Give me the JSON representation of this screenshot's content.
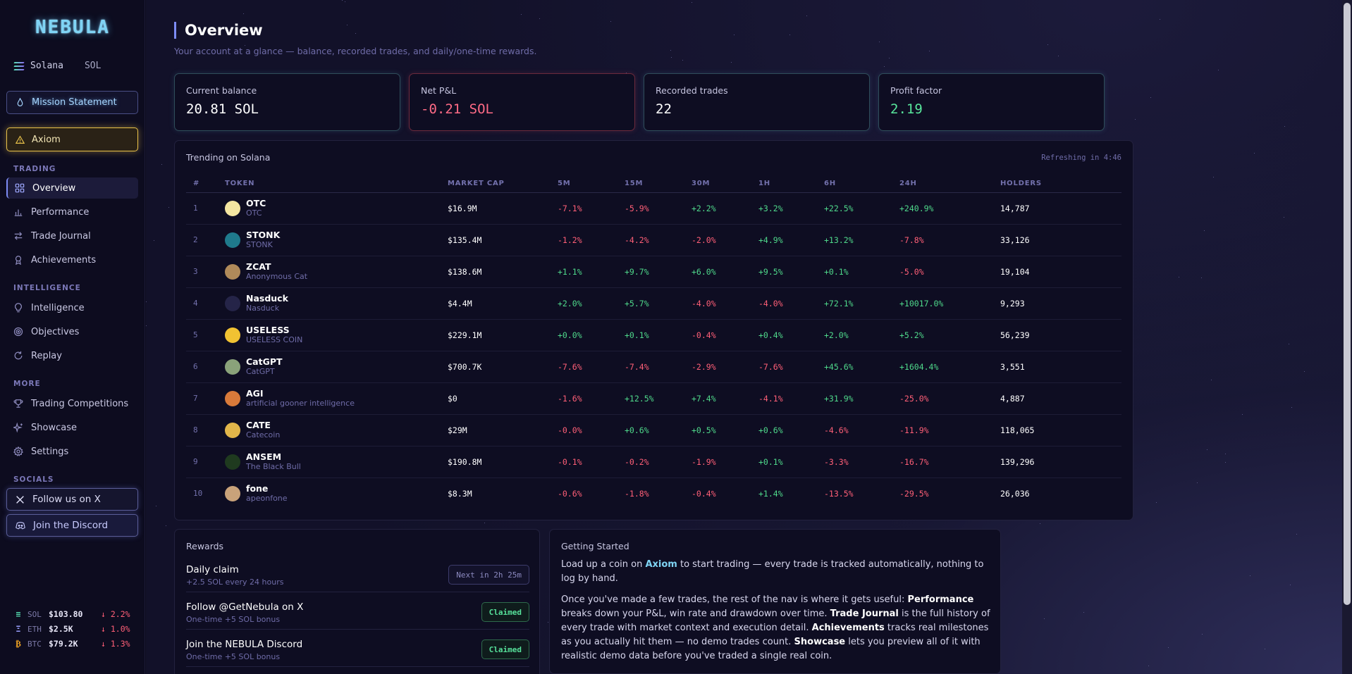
{
  "sidebar": {
    "brand": "NEBULA",
    "chain": {
      "name": "Solana",
      "ticker": "SOL"
    },
    "mission_label": "Mission Statement",
    "axiom_label": "Axiom",
    "sections": {
      "trading": "TRADING",
      "intelligence": "INTELLIGENCE",
      "more": "MORE",
      "socials": "SOCIALS"
    },
    "items": [
      {
        "label": "Overview",
        "icon": "grid-icon"
      },
      {
        "label": "Performance",
        "icon": "bar-chart-icon"
      },
      {
        "label": "Trade Journal",
        "icon": "swap-arrows-icon"
      },
      {
        "label": "Achievements",
        "icon": "award-icon"
      },
      {
        "label": "Intelligence",
        "icon": "lightbulb-icon"
      },
      {
        "label": "Objectives",
        "icon": "target-icon"
      },
      {
        "label": "Replay",
        "icon": "replay-icon"
      },
      {
        "label": "Trading Competitions",
        "icon": "trophy-icon"
      },
      {
        "label": "Showcase",
        "icon": "sparkles-icon"
      },
      {
        "label": "Settings",
        "icon": "gear-icon"
      }
    ],
    "socials": {
      "x": "Follow us on X",
      "discord": "Join the Discord"
    },
    "tickers": [
      {
        "symbol": "SOL",
        "price": "$103.80",
        "change": "↓ 2.2%"
      },
      {
        "symbol": "ETH",
        "price": "$2.5K",
        "change": "↓ 1.0%"
      },
      {
        "symbol": "BTC",
        "price": "$79.2K",
        "change": "↓ 1.3%"
      }
    ]
  },
  "header": {
    "title": "Overview",
    "subtitle": "Your account at a glance — balance, recorded trades, and daily/one-time rewards."
  },
  "stats": [
    {
      "label": "Current balance",
      "value": "20.81 SOL"
    },
    {
      "label": "Net P&L",
      "value": "-0.21 SOL"
    },
    {
      "label": "Recorded trades",
      "value": "22"
    },
    {
      "label": "Profit factor",
      "value": "2.19"
    }
  ],
  "trending": {
    "title": "Trending on Solana",
    "refresh": "Refreshing in 4:46",
    "columns": [
      "#",
      "TOKEN",
      "MARKET CAP",
      "5M",
      "15M",
      "30M",
      "1H",
      "6H",
      "24H",
      "HOLDERS"
    ],
    "rows": [
      {
        "rank": "1",
        "name": "OTC",
        "sub": "OTC",
        "mcap": "$16.9M",
        "m5": "-7.1%",
        "m15": "-5.9%",
        "m30": "+2.2%",
        "h1": "+3.2%",
        "h6": "+22.5%",
        "h24": "+240.9%",
        "holders": "14,787"
      },
      {
        "rank": "2",
        "name": "STONK",
        "sub": "STONK",
        "mcap": "$135.4M",
        "m5": "-1.2%",
        "m15": "-4.2%",
        "m30": "-2.0%",
        "h1": "+4.9%",
        "h6": "+13.2%",
        "h24": "-7.8%",
        "holders": "33,126"
      },
      {
        "rank": "3",
        "name": "ZCAT",
        "sub": "Anonymous Cat",
        "mcap": "$138.6M",
        "m5": "+1.1%",
        "m15": "+9.7%",
        "m30": "+6.0%",
        "h1": "+9.5%",
        "h6": "+0.1%",
        "h24": "-5.0%",
        "holders": "19,104"
      },
      {
        "rank": "4",
        "name": "Nasduck",
        "sub": "Nasduck",
        "mcap": "$4.4M",
        "m5": "+2.0%",
        "m15": "+5.7%",
        "m30": "-4.0%",
        "h1": "-4.0%",
        "h6": "+72.1%",
        "h24": "+10017.0%",
        "holders": "9,293"
      },
      {
        "rank": "5",
        "name": "USELESS",
        "sub": "USELESS COIN",
        "mcap": "$229.1M",
        "m5": "+0.0%",
        "m15": "+0.1%",
        "m30": "-0.4%",
        "h1": "+0.4%",
        "h6": "+2.0%",
        "h24": "+5.2%",
        "holders": "56,239"
      },
      {
        "rank": "6",
        "name": "CatGPT",
        "sub": "CatGPT",
        "mcap": "$700.7K",
        "m5": "-7.6%",
        "m15": "-7.4%",
        "m30": "-2.9%",
        "h1": "-7.6%",
        "h6": "+45.6%",
        "h24": "+1604.4%",
        "holders": "3,551"
      },
      {
        "rank": "7",
        "name": "AGI",
        "sub": "artificial gooner intelligence",
        "mcap": "$0",
        "m5": "-1.6%",
        "m15": "+12.5%",
        "m30": "+7.4%",
        "h1": "-4.1%",
        "h6": "+31.9%",
        "h24": "-25.0%",
        "holders": "4,887"
      },
      {
        "rank": "8",
        "name": "CATE",
        "sub": "Catecoin",
        "mcap": "$29M",
        "m5": "-0.0%",
        "m15": "+0.6%",
        "m30": "+0.5%",
        "h1": "+0.6%",
        "h6": "-4.6%",
        "h24": "-11.9%",
        "holders": "118,065"
      },
      {
        "rank": "9",
        "name": "ANSEM",
        "sub": "The Black Bull",
        "mcap": "$190.8M",
        "m5": "-0.1%",
        "m15": "-0.2%",
        "m30": "-1.9%",
        "h1": "+0.1%",
        "h6": "-3.3%",
        "h24": "-16.7%",
        "holders": "139,296"
      },
      {
        "rank": "10",
        "name": "fone",
        "sub": "apeonfone",
        "mcap": "$8.3M",
        "m5": "-0.6%",
        "m15": "-1.8%",
        "m30": "-0.4%",
        "h1": "+1.4%",
        "h6": "-13.5%",
        "h24": "-29.5%",
        "holders": "26,036"
      }
    ]
  },
  "rewards": {
    "title": "Rewards",
    "items": [
      {
        "title": "Daily claim",
        "sub": "+2.5 SOL every 24 hours",
        "action": "Next in 2h 25m"
      },
      {
        "title": "Follow @GetNebula on X",
        "sub": "One-time +5 SOL bonus",
        "action": "Claimed"
      },
      {
        "title": "Join the NEBULA Discord",
        "sub": "One-time +5 SOL bonus",
        "action": "Claimed"
      }
    ]
  },
  "getting_started": {
    "title": "Getting Started",
    "p1": {
      "a": "Load up a coin on ",
      "axiom": "Axiom",
      "b": " to start trading — every trade is tracked automatically, nothing to log by hand."
    },
    "p2": {
      "a": "Once you've made a few trades, the rest of the nav is where it gets useful: ",
      "performance": "Performance",
      "b": " breaks down your P&L, win rate and drawdown over time. ",
      "journal": "Trade Journal",
      "c": " is the full history of every trade with market context and execution detail. ",
      "achievements": "Achievements",
      "d": " tracks real milestones as you actually hit them — no demo trades count. ",
      "showcase": "Showcase",
      "e": " lets you preview all of it with realistic demo data before you've traded a single real coin."
    }
  },
  "colors": {
    "accent": "#7d8cf5",
    "positive": "#4fd98b",
    "negative": "#ff5f77",
    "gold": "#e9c24a",
    "cyan": "#7fd4f5"
  }
}
